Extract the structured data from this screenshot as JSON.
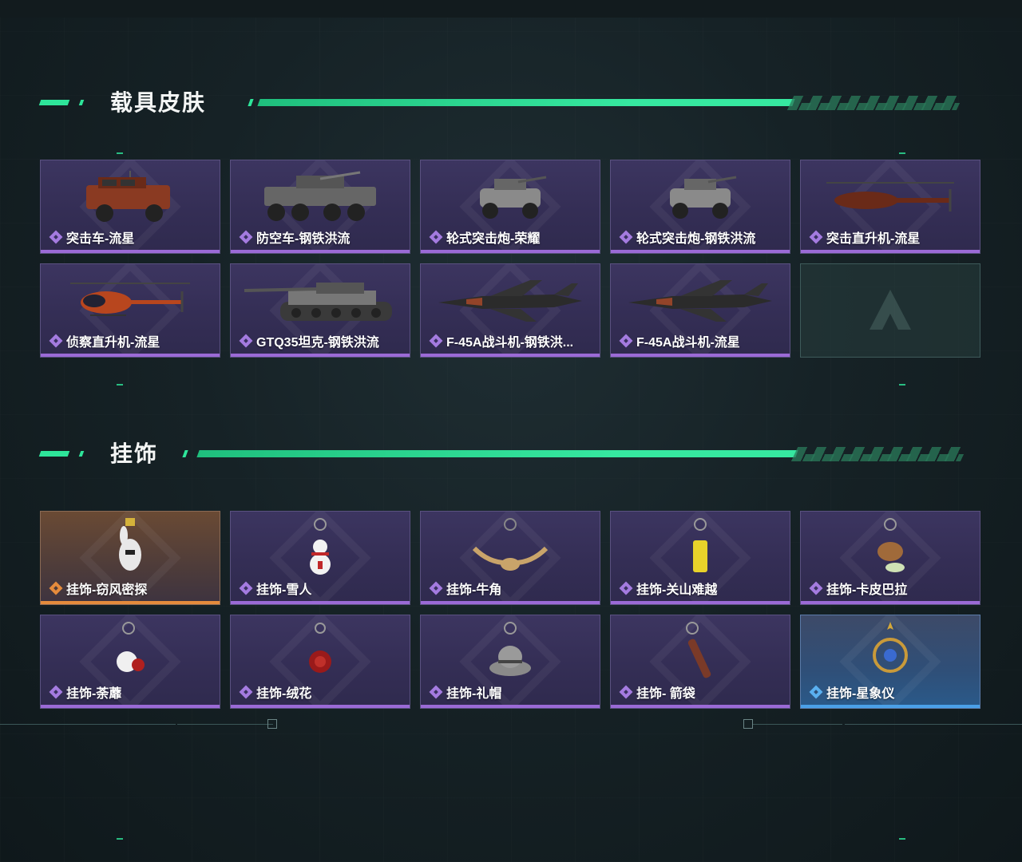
{
  "sections": [
    {
      "title": "载具皮肤",
      "items": [
        {
          "label": "突击车-流星",
          "rarity": "purple",
          "icon": "armored-car-icon"
        },
        {
          "label": "防空车-钢铁洪流",
          "rarity": "purple",
          "icon": "anti-air-vehicle-icon"
        },
        {
          "label": "轮式突击炮-荣耀",
          "rarity": "purple",
          "icon": "wheeled-assault-gun-icon"
        },
        {
          "label": "轮式突击炮-钢铁洪流",
          "rarity": "purple",
          "icon": "wheeled-assault-gun-icon"
        },
        {
          "label": "突击直升机-流星",
          "rarity": "purple",
          "icon": "attack-helicopter-icon"
        },
        {
          "label": "侦察直升机-流星",
          "rarity": "purple",
          "icon": "scout-helicopter-icon"
        },
        {
          "label": "GTQ35坦克-钢铁洪流",
          "rarity": "purple",
          "icon": "tank-icon"
        },
        {
          "label": "F-45A战斗机-钢铁洪...",
          "rarity": "purple",
          "icon": "fighter-jet-icon"
        },
        {
          "label": "F-45A战斗机-流星",
          "rarity": "purple",
          "icon": "fighter-jet-icon"
        },
        {
          "label": "",
          "rarity": "empty",
          "icon": "empty-slot-logo-icon"
        }
      ]
    },
    {
      "title": "挂饰",
      "items": [
        {
          "label": "挂饰-窃风密探",
          "rarity": "orange",
          "icon": "rabbit-charm-icon"
        },
        {
          "label": "挂饰-雪人",
          "rarity": "purple",
          "icon": "snowman-charm-icon"
        },
        {
          "label": "挂饰-牛角",
          "rarity": "purple",
          "icon": "bull-horn-charm-icon"
        },
        {
          "label": "挂饰-关山难越",
          "rarity": "purple",
          "icon": "scroll-charm-icon"
        },
        {
          "label": "挂饰-卡皮巴拉",
          "rarity": "purple",
          "icon": "capybara-charm-icon"
        },
        {
          "label": "挂饰-荼蘼",
          "rarity": "purple",
          "icon": "flower-charm-icon"
        },
        {
          "label": "挂饰-绒花",
          "rarity": "purple",
          "icon": "rose-charm-icon"
        },
        {
          "label": "挂饰-礼帽",
          "rarity": "purple",
          "icon": "fedora-charm-icon"
        },
        {
          "label": "挂饰- 箭袋",
          "rarity": "purple",
          "icon": "quiver-charm-icon"
        },
        {
          "label": "挂饰-星象仪",
          "rarity": "blue",
          "icon": "astrolabe-charm-icon"
        }
      ]
    }
  ],
  "colors": {
    "accent": "#2ee59a",
    "purple": "#9b6ad6",
    "orange": "#e58b3c",
    "blue": "#4aa0e8"
  }
}
